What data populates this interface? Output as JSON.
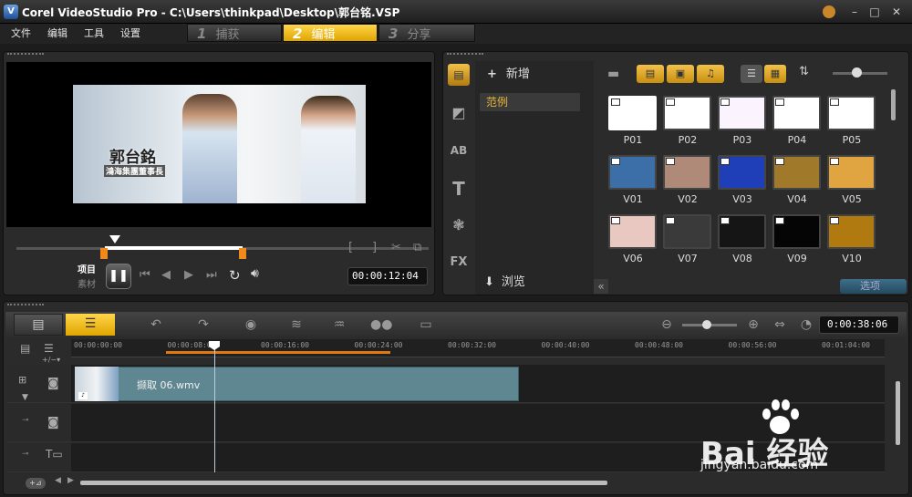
{
  "window": {
    "title": "Corel VideoStudio Pro - C:\\Users\\thinkpad\\Desktop\\郭台铭.VSP",
    "logo": "V"
  },
  "menu": [
    "文件",
    "编辑",
    "工具",
    "设置"
  ],
  "steps": [
    {
      "num": "1",
      "label": "捕获"
    },
    {
      "num": "2",
      "label": "编辑"
    },
    {
      "num": "3",
      "label": "分享"
    }
  ],
  "preview": {
    "overlay_name": "郭台銘",
    "overlay_sub": "鴻海集團董事長",
    "mode_project": "项目",
    "mode_clip": "素材",
    "timecode": "00:00:12:04"
  },
  "library": {
    "add_label": "新增",
    "folder": "范例",
    "browse_label": "浏览",
    "options_label": "选项",
    "thumbs": [
      {
        "label": "P01",
        "color": "#ffffff",
        "type": "photo"
      },
      {
        "label": "P02",
        "color": "#ffffff",
        "type": "photo"
      },
      {
        "label": "P03",
        "color": "#fbf4ff",
        "type": "photo"
      },
      {
        "label": "P04",
        "color": "#ffffff",
        "type": "photo"
      },
      {
        "label": "P05",
        "color": "#ffffff",
        "type": "photo"
      },
      {
        "label": "V01",
        "color": "#3c6ea8",
        "type": "video"
      },
      {
        "label": "V02",
        "color": "#b08a78",
        "type": "video"
      },
      {
        "label": "V03",
        "color": "#1f3fb8",
        "type": "video"
      },
      {
        "label": "V04",
        "color": "#a07a2a",
        "type": "video"
      },
      {
        "label": "V05",
        "color": "#e0a440",
        "type": "video"
      },
      {
        "label": "V06",
        "color": "#e8c8c0",
        "type": "video"
      },
      {
        "label": "V07",
        "color": "#3a3a3a",
        "type": "video"
      },
      {
        "label": "V08",
        "color": "#151515",
        "type": "video"
      },
      {
        "label": "V09",
        "color": "#050505",
        "type": "video"
      },
      {
        "label": "V10",
        "color": "#b07a10",
        "type": "video"
      }
    ]
  },
  "timeline": {
    "timecode": "0:00:38:06",
    "ticks": [
      "00:00:00:00",
      "00:00:08:00",
      "00:00:16:00",
      "00:00:24:00",
      "00:00:32:00",
      "00:00:40:00",
      "00:00:48:00",
      "00:00:56:00",
      "00:01:04:00"
    ],
    "clip_label": "撷取 06.wmv"
  },
  "watermark": {
    "brand": "Bai 经验",
    "url": "jingyan.baidu.com"
  }
}
